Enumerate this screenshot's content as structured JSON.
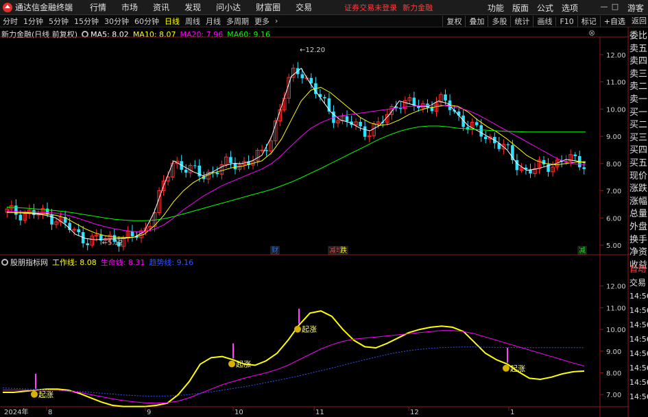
{
  "window": {
    "title": "通达信金融终端",
    "menu": [
      "行情",
      "市场",
      "资讯",
      "发现",
      "问小达",
      "财富圈",
      "交易"
    ],
    "alert_login": "证券交易未登录",
    "alert_stock": "新力金融",
    "right_menu": [
      "功能",
      "版面",
      "公式",
      "选项"
    ],
    "guest": "游客"
  },
  "toolbar": {
    "periods": [
      "分时",
      "1分钟",
      "5分钟",
      "15分钟",
      "30分钟",
      "60分钟",
      "日线",
      "周线",
      "月线",
      "多周期",
      "更多"
    ],
    "active_period": "日线",
    "more_arrow": "›",
    "right_tools": [
      "复权",
      "叠加",
      "多股",
      "统计",
      "画线",
      "F10",
      "标记",
      "+自选"
    ],
    "back": "返回"
  },
  "main_legend": {
    "stock": "新力金融(日线 前复权)",
    "ma": [
      {
        "label": "MA5: 8.02",
        "color": "#ffffff"
      },
      {
        "label": "MA10: 8.07",
        "color": "#ffff00"
      },
      {
        "label": "MA20: 7.96",
        "color": "#ff00ff"
      },
      {
        "label": "MA60: 9.16",
        "color": "#00ff00"
      }
    ]
  },
  "indicator_legend": {
    "name": "股朋指标网",
    "lines": [
      {
        "label": "工作线: 8.08",
        "color": "#ffff00"
      },
      {
        "label": "生命线: 8.31",
        "color": "#ff00ff"
      },
      {
        "label": "趋势线: 9.16",
        "color": "#3355ff"
      }
    ]
  },
  "quote_panel": [
    "委比",
    "卖五",
    "卖四",
    "卖三",
    "卖二",
    "卖一",
    "买一",
    "买二",
    "买三",
    "买四",
    "买五",
    "现价",
    "涨跌",
    "涨幅",
    "总量",
    "外盘",
    "换手",
    "净资",
    "收益"
  ],
  "quote_panel_tabs": [
    "自动",
    "交易"
  ],
  "quote_times": [
    "14:56",
    "14:56",
    "14:56",
    "14:56",
    "14:56",
    "14:56",
    "14:56",
    "14:56"
  ],
  "chart_data": [
    {
      "type": "candlestick",
      "title": "新力金融(日线 前复权)",
      "ylim": [
        4.7,
        12.6
      ],
      "yticks": [
        "12.00",
        "11.00",
        "10.00",
        "9.00",
        "8.00",
        "7.00",
        "6.00",
        "5.00"
      ],
      "annotations": [
        {
          "text": "12.20",
          "kind": "high"
        },
        {
          "text": "5.12",
          "kind": "low"
        }
      ],
      "event_markers": [
        "财",
        "减",
        "增",
        "跌",
        "减"
      ],
      "series": [
        {
          "name": "MA5",
          "values": [
            6.21,
            6.19,
            6.18,
            6.15,
            6.1,
            6.0,
            5.75,
            5.4,
            5.25,
            5.2,
            5.22,
            5.23,
            5.25,
            5.3,
            5.5,
            6.2,
            7.2,
            8.1,
            7.9,
            7.7,
            7.55,
            7.7,
            7.9,
            8.0,
            8.0,
            8.1,
            8.3,
            9.0,
            10.1,
            11.2,
            11.5,
            10.9,
            10.4,
            9.9,
            9.6,
            9.5,
            9.3,
            9.2,
            9.4,
            9.8,
            10.3,
            10.2,
            10.1,
            10.1,
            10.3,
            10.2,
            9.8,
            9.4,
            9.2,
            9.0,
            8.8,
            8.5,
            8.0,
            7.75,
            7.8,
            7.9,
            8.0,
            8.15,
            8.1,
            8.02
          ]
        },
        {
          "name": "MA10",
          "values": [
            6.2,
            6.2,
            6.2,
            6.18,
            6.15,
            6.1,
            6.0,
            5.8,
            5.6,
            5.45,
            5.35,
            5.3,
            5.28,
            5.3,
            5.4,
            5.7,
            6.1,
            6.6,
            7.0,
            7.3,
            7.5,
            7.65,
            7.75,
            7.85,
            7.9,
            8.0,
            8.1,
            8.4,
            8.9,
            9.6,
            10.3,
            10.7,
            10.8,
            10.6,
            10.3,
            10.0,
            9.7,
            9.5,
            9.4,
            9.45,
            9.6,
            9.8,
            9.95,
            10.05,
            10.1,
            10.15,
            10.1,
            9.9,
            9.6,
            9.35,
            9.15,
            8.9,
            8.6,
            8.3,
            8.1,
            8.0,
            7.95,
            8.0,
            8.05,
            8.07
          ]
        },
        {
          "name": "MA20",
          "values": [
            6.25,
            6.24,
            6.23,
            6.22,
            6.2,
            6.18,
            6.12,
            6.02,
            5.9,
            5.78,
            5.68,
            5.6,
            5.54,
            5.5,
            5.5,
            5.58,
            5.75,
            6.0,
            6.3,
            6.55,
            6.8,
            7.0,
            7.2,
            7.35,
            7.5,
            7.65,
            7.8,
            8.0,
            8.3,
            8.65,
            9.0,
            9.3,
            9.5,
            9.65,
            9.75,
            9.8,
            9.85,
            9.9,
            9.95,
            10.0,
            10.05,
            10.1,
            10.12,
            10.14,
            10.15,
            10.12,
            10.05,
            9.95,
            9.8,
            9.6,
            9.4,
            9.2,
            9.0,
            8.8,
            8.6,
            8.4,
            8.2,
            8.05,
            7.98,
            7.96
          ]
        },
        {
          "name": "MA60",
          "values": [
            6.4,
            6.38,
            6.36,
            6.33,
            6.3,
            6.27,
            6.23,
            6.18,
            6.12,
            6.06,
            6.0,
            5.95,
            5.92,
            5.9,
            5.9,
            5.92,
            5.97,
            6.05,
            6.15,
            6.25,
            6.35,
            6.45,
            6.55,
            6.65,
            6.75,
            6.85,
            6.95,
            7.05,
            7.18,
            7.32,
            7.48,
            7.65,
            7.82,
            8.0,
            8.18,
            8.36,
            8.54,
            8.72,
            8.9,
            9.05,
            9.18,
            9.28,
            9.35,
            9.38,
            9.38,
            9.35,
            9.3,
            9.28,
            9.25,
            9.22,
            9.2,
            9.18,
            9.17,
            9.16,
            9.16,
            9.16,
            9.16,
            9.16,
            9.16,
            9.16
          ]
        }
      ]
    },
    {
      "type": "line",
      "title": "股朋指标网",
      "ylim": [
        6.5,
        13.0
      ],
      "yticks": [
        "12.00",
        "11.00",
        "10.00",
        "9.00",
        "8.00",
        "7.00"
      ],
      "xticks": [
        "2024年",
        "8",
        "9",
        "10",
        "11",
        "12",
        "1"
      ],
      "signal_label": "起涨",
      "signals": [
        3,
        21,
        27,
        46
      ],
      "series": [
        {
          "name": "工作线",
          "values": [
            7.1,
            7.1,
            7.15,
            7.2,
            7.25,
            7.25,
            7.2,
            7.05,
            6.85,
            6.65,
            6.5,
            6.45,
            6.45,
            6.45,
            6.5,
            6.6,
            7.0,
            7.6,
            8.4,
            8.7,
            8.75,
            8.6,
            8.4,
            8.35,
            8.55,
            8.9,
            9.5,
            10.2,
            10.75,
            10.85,
            10.6,
            10.0,
            9.5,
            9.2,
            9.15,
            9.35,
            9.6,
            9.85,
            10.0,
            10.1,
            10.15,
            10.1,
            9.9,
            9.4,
            8.9,
            8.6,
            8.4,
            8.05,
            7.75,
            7.7,
            7.8,
            7.95,
            8.05,
            8.08
          ]
        },
        {
          "name": "生命线",
          "values": [
            7.2,
            7.2,
            7.2,
            7.2,
            7.2,
            7.2,
            7.15,
            7.1,
            7.0,
            6.9,
            6.8,
            6.72,
            6.66,
            6.62,
            6.6,
            6.62,
            6.7,
            6.85,
            7.05,
            7.25,
            7.45,
            7.6,
            7.75,
            7.88,
            8.0,
            8.15,
            8.35,
            8.6,
            8.85,
            9.1,
            9.3,
            9.45,
            9.55,
            9.6,
            9.65,
            9.7,
            9.75,
            9.8,
            9.85,
            9.9,
            9.95,
            9.95,
            9.9,
            9.8,
            9.65,
            9.5,
            9.35,
            9.2,
            9.05,
            8.9,
            8.75,
            8.6,
            8.45,
            8.31
          ]
        },
        {
          "name": "趋势线",
          "values": [
            7.3,
            7.28,
            7.26,
            7.24,
            7.22,
            7.2,
            7.17,
            7.14,
            7.1,
            7.06,
            7.02,
            6.98,
            6.95,
            6.93,
            6.92,
            6.93,
            6.96,
            7.0,
            7.06,
            7.12,
            7.2,
            7.28,
            7.36,
            7.45,
            7.55,
            7.65,
            7.75,
            7.86,
            7.98,
            8.1,
            8.22,
            8.35,
            8.48,
            8.6,
            8.72,
            8.84,
            8.94,
            9.02,
            9.08,
            9.13,
            9.16,
            9.18,
            9.19,
            9.19,
            9.18,
            9.17,
            9.17,
            9.16,
            9.16,
            9.16,
            9.16,
            9.16,
            9.16,
            9.16
          ]
        }
      ]
    }
  ]
}
